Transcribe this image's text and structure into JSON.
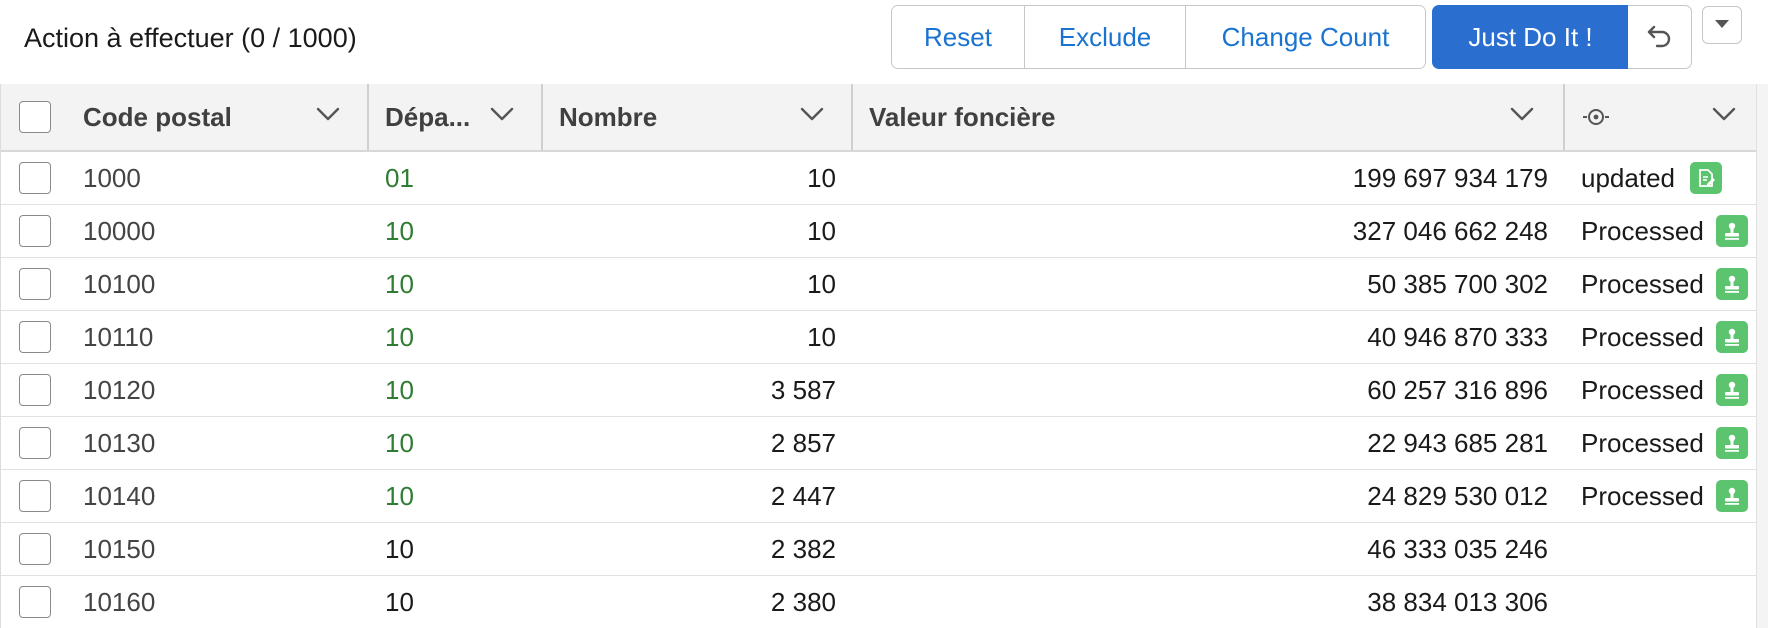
{
  "header": {
    "title": "Action à effectuer (0 / 1000)",
    "buttons": {
      "reset": "Reset",
      "exclude": "Exclude",
      "change_count": "Change Count",
      "just_do_it": "Just Do It !"
    },
    "icons": {
      "undo": "undo-icon",
      "menu": "caret-down-icon"
    }
  },
  "colors": {
    "accent": "#2a6fd0",
    "link": "#1a73d1",
    "green_text": "#2e7d32",
    "status_icon": "#5cc46f"
  },
  "table": {
    "columns": [
      {
        "key": "code",
        "label": "Code postal"
      },
      {
        "key": "dep",
        "label": "Dépa..."
      },
      {
        "key": "nombre",
        "label": "Nombre"
      },
      {
        "key": "valeur",
        "label": "Valeur foncière"
      },
      {
        "key": "status",
        "label": "",
        "icon": "target-icon"
      }
    ],
    "rows": [
      {
        "code": "1000",
        "dep": "01",
        "dep_green": true,
        "nombre": "10",
        "valeur": "199 697 934 179",
        "status": "updated",
        "status_icon": "edit-document-icon"
      },
      {
        "code": "10000",
        "dep": "10",
        "dep_green": true,
        "nombre": "10",
        "valeur": "327 046 662 248",
        "status": "Processed",
        "status_icon": "stamp-icon"
      },
      {
        "code": "10100",
        "dep": "10",
        "dep_green": true,
        "nombre": "10",
        "valeur": "50 385 700 302",
        "status": "Processed",
        "status_icon": "stamp-icon"
      },
      {
        "code": "10110",
        "dep": "10",
        "dep_green": true,
        "nombre": "10",
        "valeur": "40 946 870 333",
        "status": "Processed",
        "status_icon": "stamp-icon"
      },
      {
        "code": "10120",
        "dep": "10",
        "dep_green": true,
        "nombre": "3 587",
        "valeur": "60 257 316 896",
        "status": "Processed",
        "status_icon": "stamp-icon"
      },
      {
        "code": "10130",
        "dep": "10",
        "dep_green": true,
        "nombre": "2 857",
        "valeur": "22 943 685 281",
        "status": "Processed",
        "status_icon": "stamp-icon"
      },
      {
        "code": "10140",
        "dep": "10",
        "dep_green": true,
        "nombre": "2 447",
        "valeur": "24 829 530 012",
        "status": "Processed",
        "status_icon": "stamp-icon"
      },
      {
        "code": "10150",
        "dep": "10",
        "dep_green": false,
        "nombre": "2 382",
        "valeur": "46 333 035 246",
        "status": "",
        "status_icon": ""
      },
      {
        "code": "10160",
        "dep": "10",
        "dep_green": false,
        "nombre": "2 380",
        "valeur": "38 834 013 306",
        "status": "",
        "status_icon": ""
      }
    ]
  }
}
